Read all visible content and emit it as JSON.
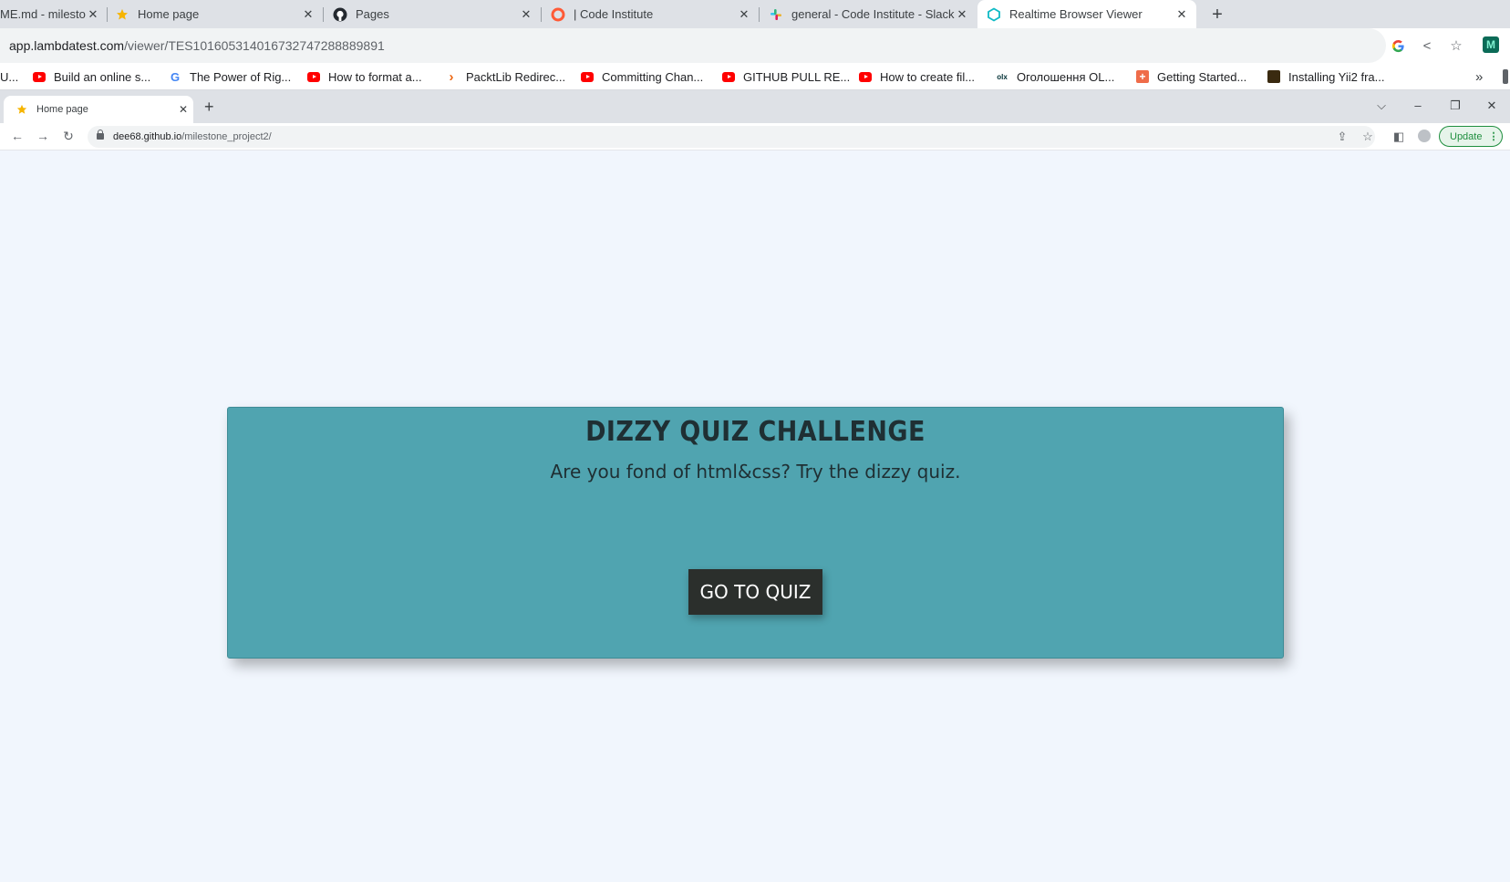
{
  "outer_tabs": [
    {
      "title": "ME.md - milesto",
      "icon": "document-icon"
    },
    {
      "title": "Home page",
      "icon": "star-icon"
    },
    {
      "title": "Pages",
      "icon": "github-icon"
    },
    {
      "title": "| Code Institute",
      "icon": "code-institute-icon"
    },
    {
      "title": "general - Code Institute - Slack",
      "icon": "slack-icon"
    },
    {
      "title": "Realtime Browser Viewer",
      "icon": "lambdatest-icon",
      "active": true
    }
  ],
  "outer_address": {
    "domain": "app.lambdatest.com",
    "path": "/viewer/TES101605314016732747288889891"
  },
  "bookmarks": [
    {
      "label": "U...",
      "icon": "none"
    },
    {
      "label": "Build an online s...",
      "icon": "youtube-icon"
    },
    {
      "label": "The Power of Rig...",
      "icon": "google-icon"
    },
    {
      "label": "How to format a...",
      "icon": "youtube-icon"
    },
    {
      "label": "PacktLib Redirec...",
      "icon": "packt-icon"
    },
    {
      "label": "Committing Chan...",
      "icon": "youtube-icon"
    },
    {
      "label": "GITHUB PULL RE...",
      "icon": "youtube-icon"
    },
    {
      "label": "How to create fil...",
      "icon": "youtube-icon"
    },
    {
      "label": "Оголошення OL...",
      "icon": "olx-icon"
    },
    {
      "label": "Getting Started...",
      "icon": "plus-square-icon"
    },
    {
      "label": "Installing Yii2 fra...",
      "icon": "yii-icon"
    }
  ],
  "inner_browser": {
    "tab_title": "Home page",
    "url_domain": "dee68.github.io",
    "url_path": "/milestone_project2/",
    "update_label": "Update"
  },
  "page": {
    "title": "DIZZY QUIZ CHALLENGE",
    "subtitle": "Are you fond of html&css? Try the dizzy quiz.",
    "button_label": "GO TO QUIZ"
  },
  "colors": {
    "card": "#50a4b0",
    "button": "#2b2f2c",
    "page_bg": "#f1f6fd"
  }
}
